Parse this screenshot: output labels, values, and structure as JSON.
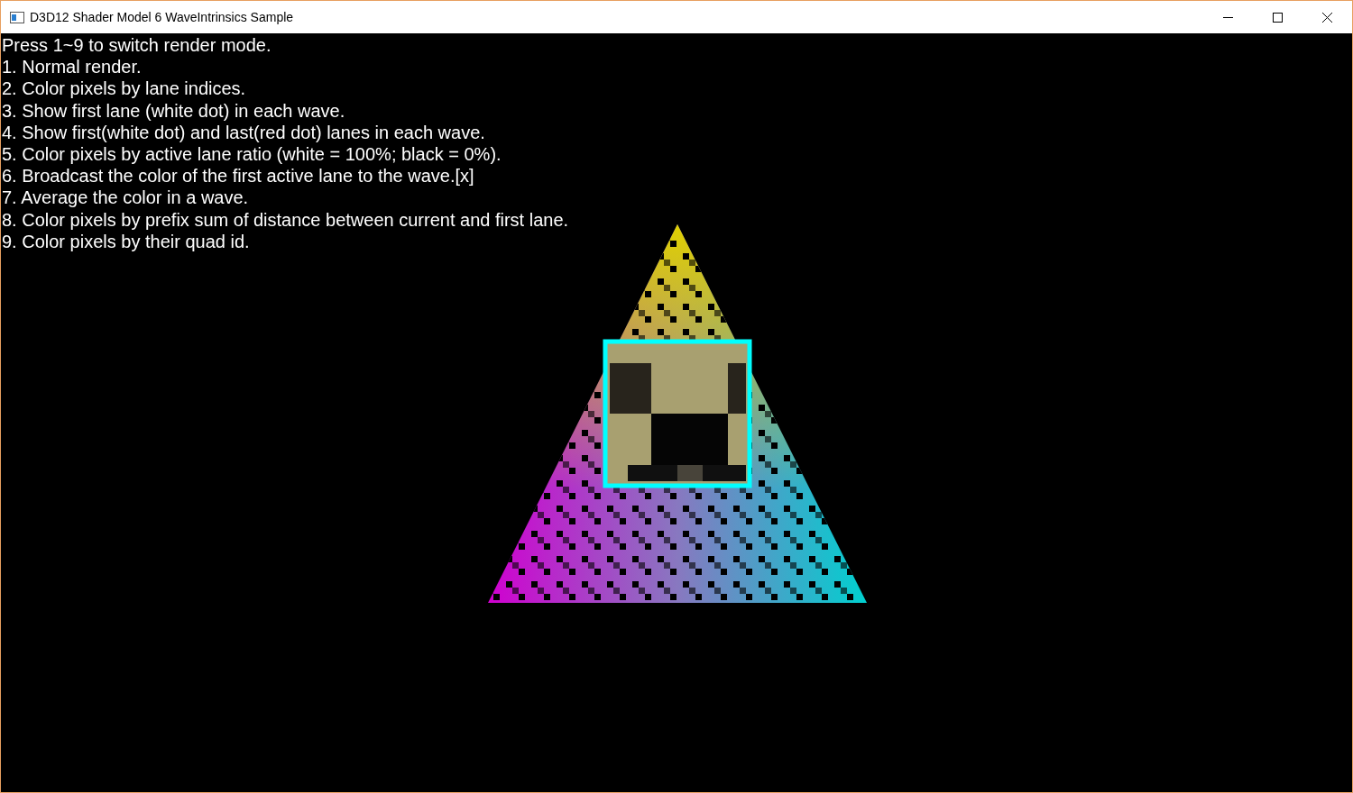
{
  "window": {
    "title": "D3D12 Shader Model 6 WaveIntrinsics Sample"
  },
  "overlay": {
    "heading": "Press 1~9 to switch render mode.",
    "modes": [
      "1. Normal render.",
      "2. Color pixels by lane indices.",
      "3. Show first lane (white dot) in each wave.",
      "4. Show first(white dot) and last(red dot) lanes in each wave.",
      "5. Color pixels by active lane ratio (white = 100%; black = 0%).",
      "6. Broadcast the color of the first active lane to the wave.[x]",
      "7. Average the color in a wave.",
      "8. Color pixels by prefix sum of distance between current and first lane.",
      "9. Color pixels by their quad id."
    ]
  }
}
